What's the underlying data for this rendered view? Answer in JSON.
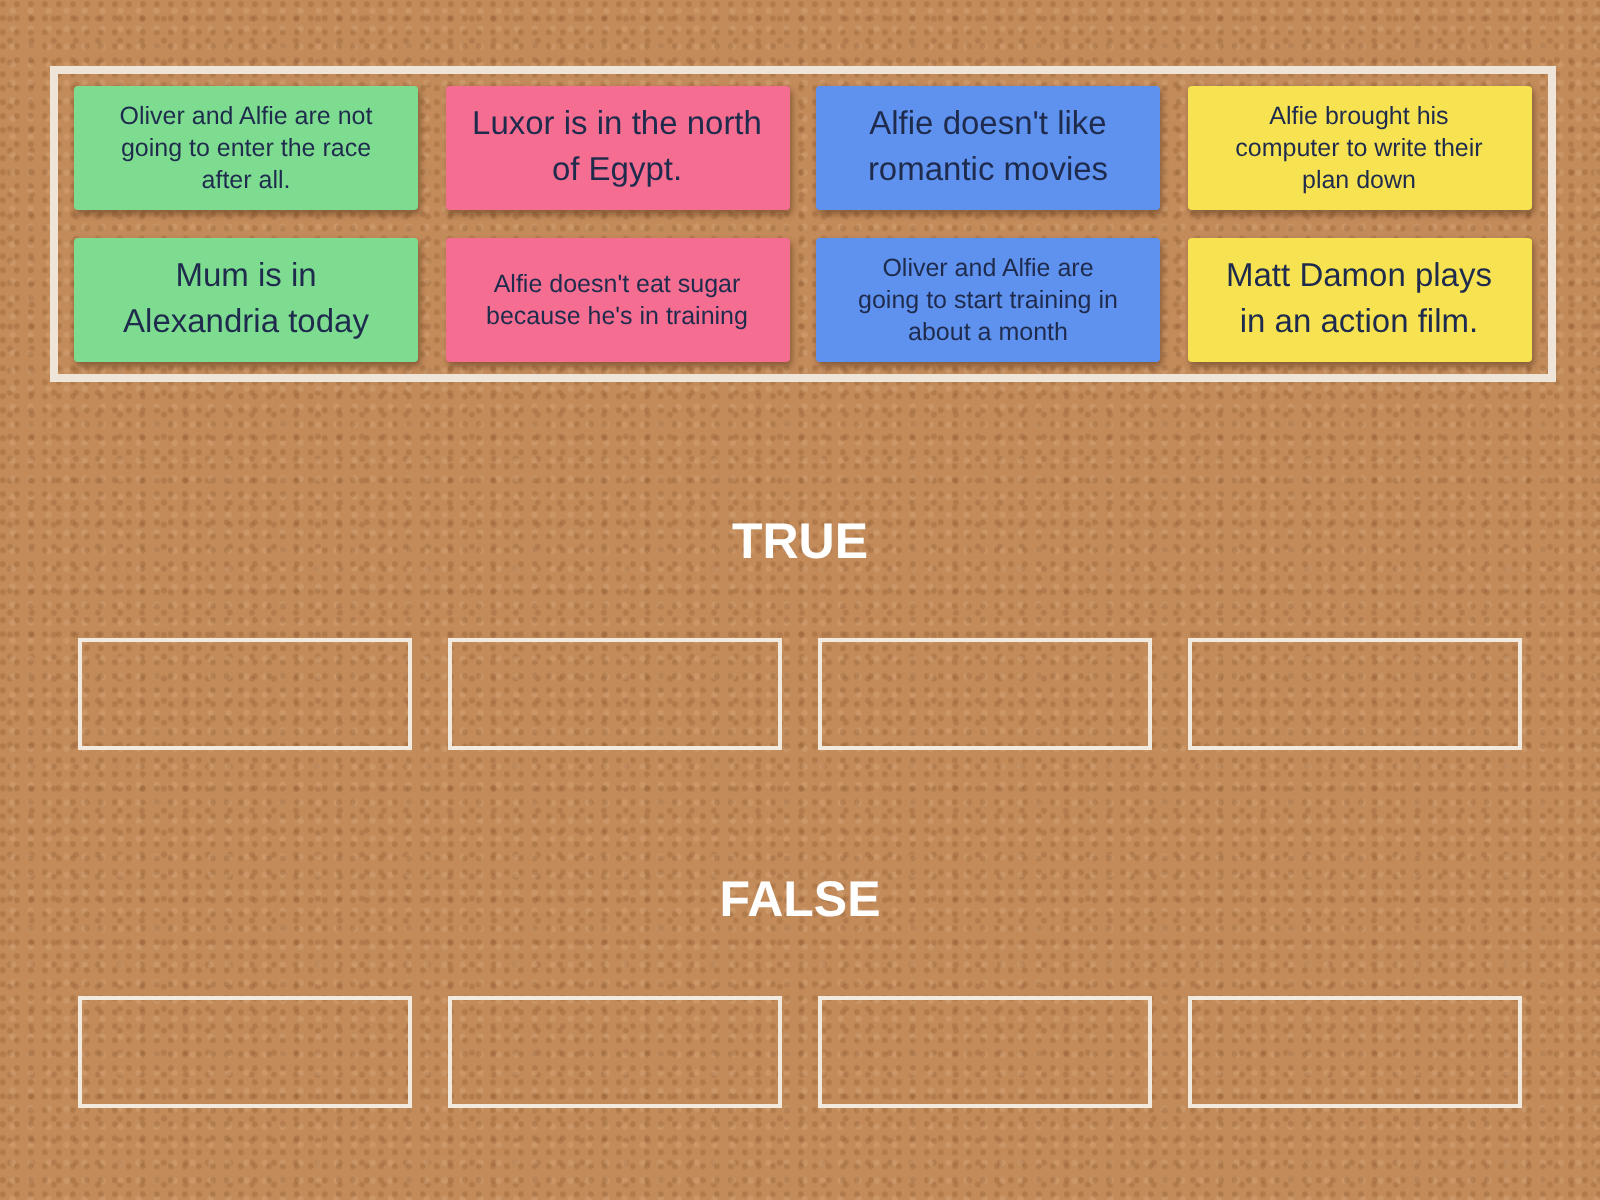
{
  "cards": [
    {
      "text": "Oliver and Alfie are not going to enter the race after all.",
      "color": "#7ddc8f"
    },
    {
      "text": "Luxor is in the north of Egypt.",
      "color": "#f56d90"
    },
    {
      "text": "Alfie doesn't like romantic movies",
      "color": "#5f91ee"
    },
    {
      "text": "Alfie brought his computer to write their plan down",
      "color": "#f7e251"
    },
    {
      "text": "Mum is in Alexandria today",
      "color": "#7ddc8f"
    },
    {
      "text": "Alfie doesn't eat sugar because he's in training",
      "color": "#f56d90"
    },
    {
      "text": "Oliver and Alfie are going to start training in about a month",
      "color": "#5f91ee"
    },
    {
      "text": "Matt Damon plays in an action film.",
      "color": "#f7e251"
    }
  ],
  "groups": [
    {
      "title": "TRUE",
      "slots": [
        {
          "kind": "empty"
        },
        {
          "kind": "empty"
        },
        {
          "kind": "empty"
        },
        {
          "kind": "empty"
        }
      ]
    },
    {
      "title": "FALSE",
      "slots": [
        {
          "kind": "empty"
        },
        {
          "kind": "empty"
        },
        {
          "kind": "empty"
        },
        {
          "kind": "empty"
        }
      ]
    }
  ]
}
